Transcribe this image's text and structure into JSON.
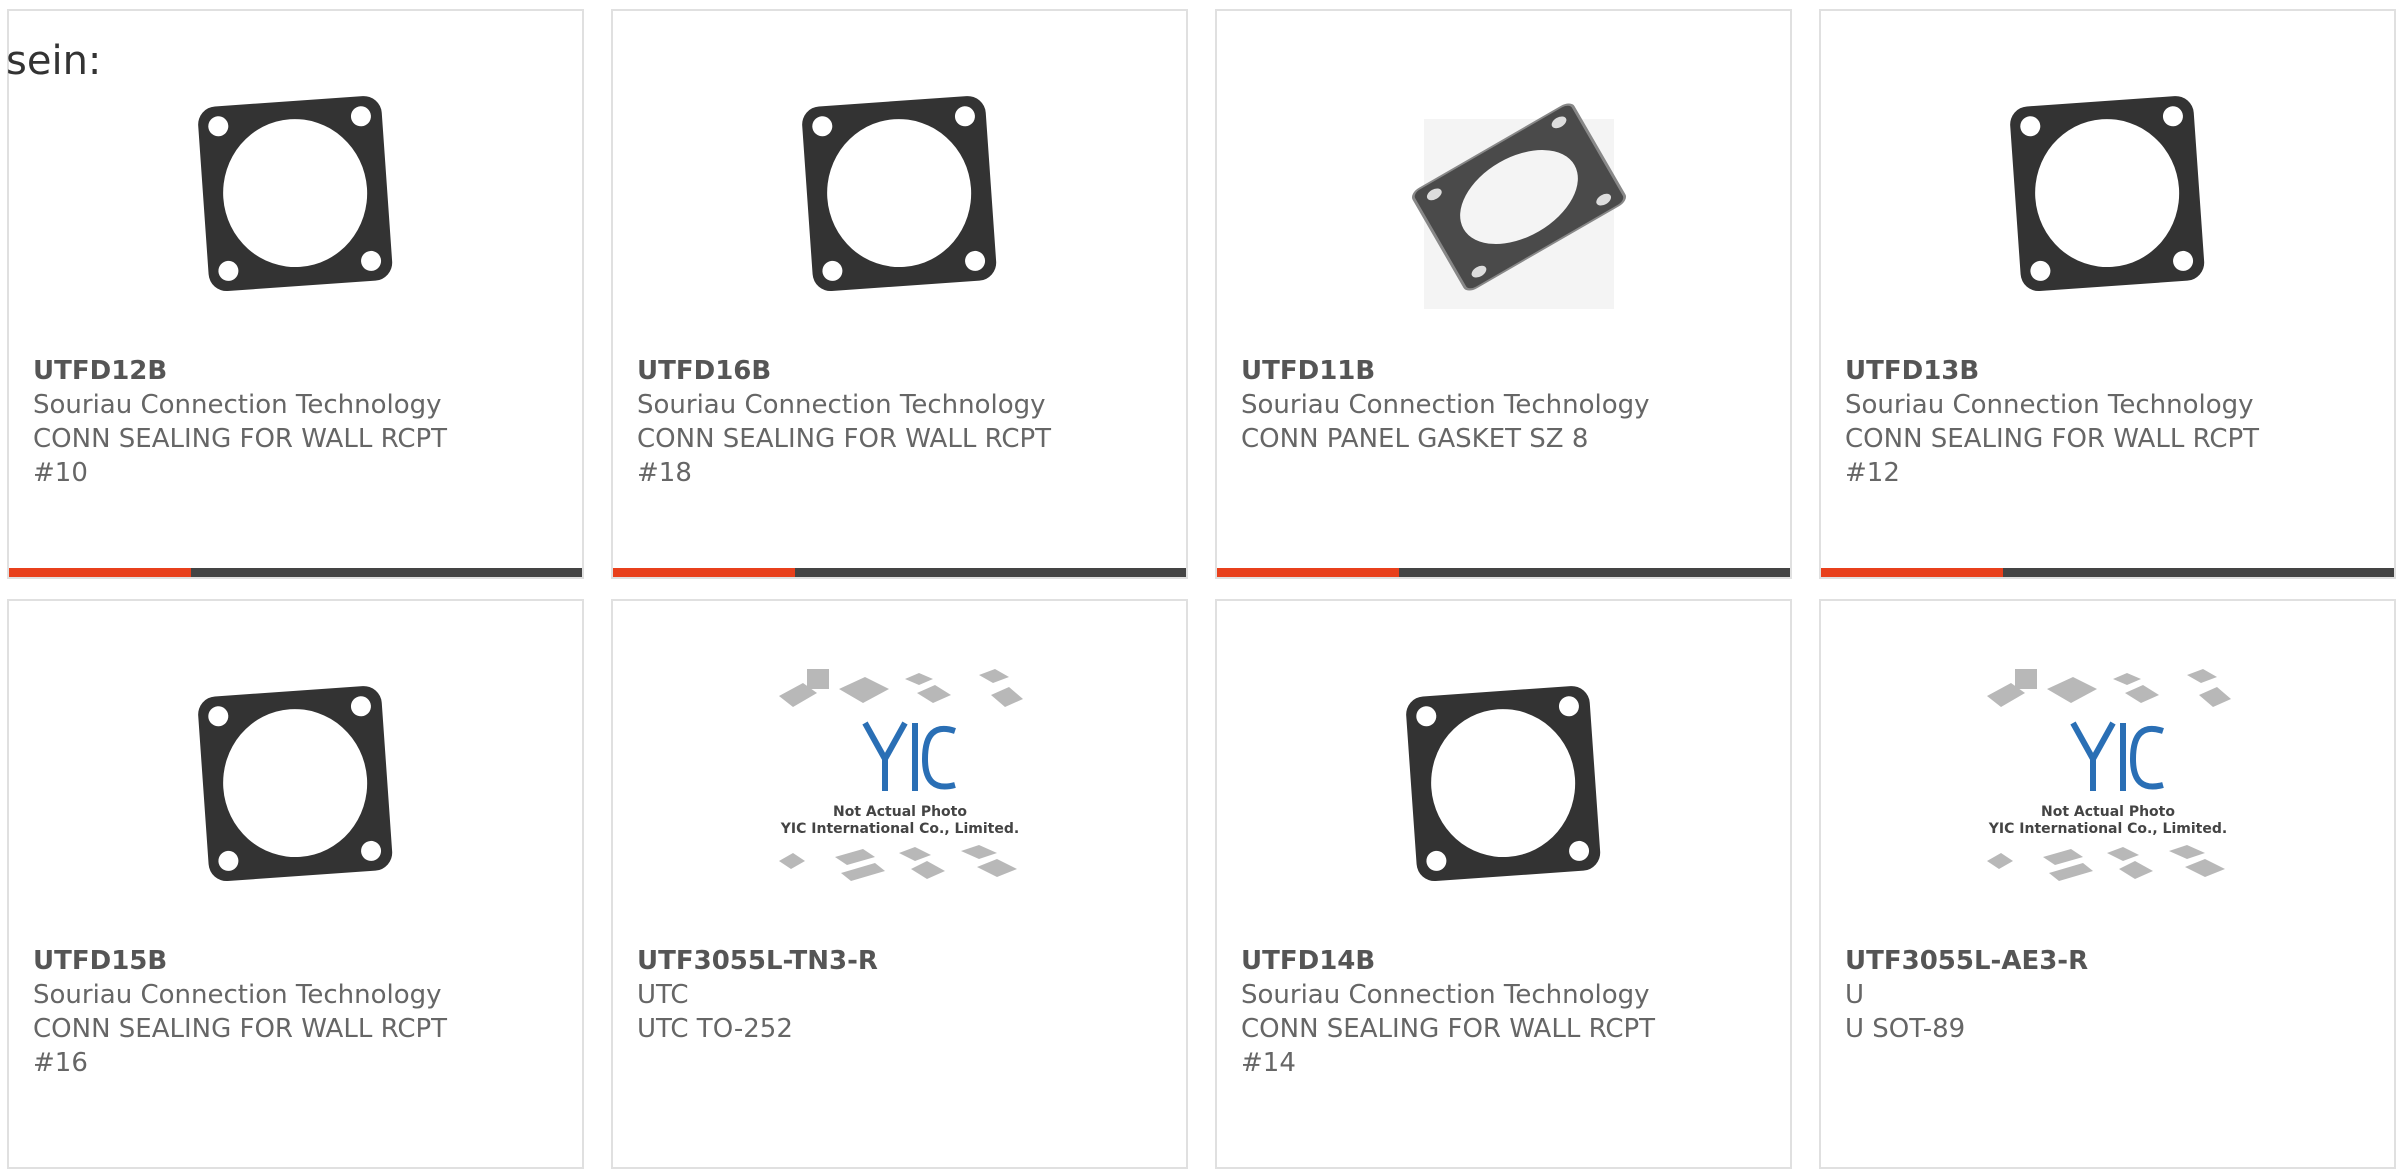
{
  "heading": "sein:",
  "colors": {
    "accent": "#e8401c",
    "bar": "#444444",
    "border": "#e0e0e0",
    "text": "#666666"
  },
  "products": [
    {
      "part": "UTFD12B",
      "maker": "Souriau Connection Technology",
      "desc": "CONN SEALING FOR WALL RCPT",
      "desc2": "#10",
      "image": "gasket-icon"
    },
    {
      "part": "UTFD16B",
      "maker": "Souriau Connection Technology",
      "desc": "CONN SEALING FOR WALL RCPT",
      "desc2": "#18",
      "image": "gasket-icon"
    },
    {
      "part": "UTFD11B",
      "maker": "Souriau Connection Technology",
      "desc": "CONN PANEL GASKET SZ 8",
      "desc2": "",
      "image": "panel-gasket-icon"
    },
    {
      "part": "UTFD13B",
      "maker": "Souriau Connection Technology",
      "desc": "CONN SEALING FOR WALL RCPT",
      "desc2": "#12",
      "image": "gasket-icon"
    },
    {
      "part": "UTFD15B",
      "maker": "Souriau Connection Technology",
      "desc": "CONN SEALING FOR WALL RCPT",
      "desc2": "#16",
      "image": "gasket-icon"
    },
    {
      "part": "UTF3055L-TN3-R",
      "maker": "UTC",
      "desc": "UTC TO-252",
      "desc2": "",
      "image": "not-actual-photo-icon"
    },
    {
      "part": "UTFD14B",
      "maker": "Souriau Connection Technology",
      "desc": "CONN SEALING FOR WALL RCPT",
      "desc2": "#14",
      "image": "gasket-icon"
    },
    {
      "part": "UTF3055L-AE3-R",
      "maker": "U",
      "desc": "U SOT-89",
      "desc2": "",
      "image": "not-actual-photo-icon"
    }
  ],
  "placeholder": {
    "line1": "Not Actual Photo",
    "line2": "YIC International Co., Limited.",
    "logo": "YIC"
  }
}
